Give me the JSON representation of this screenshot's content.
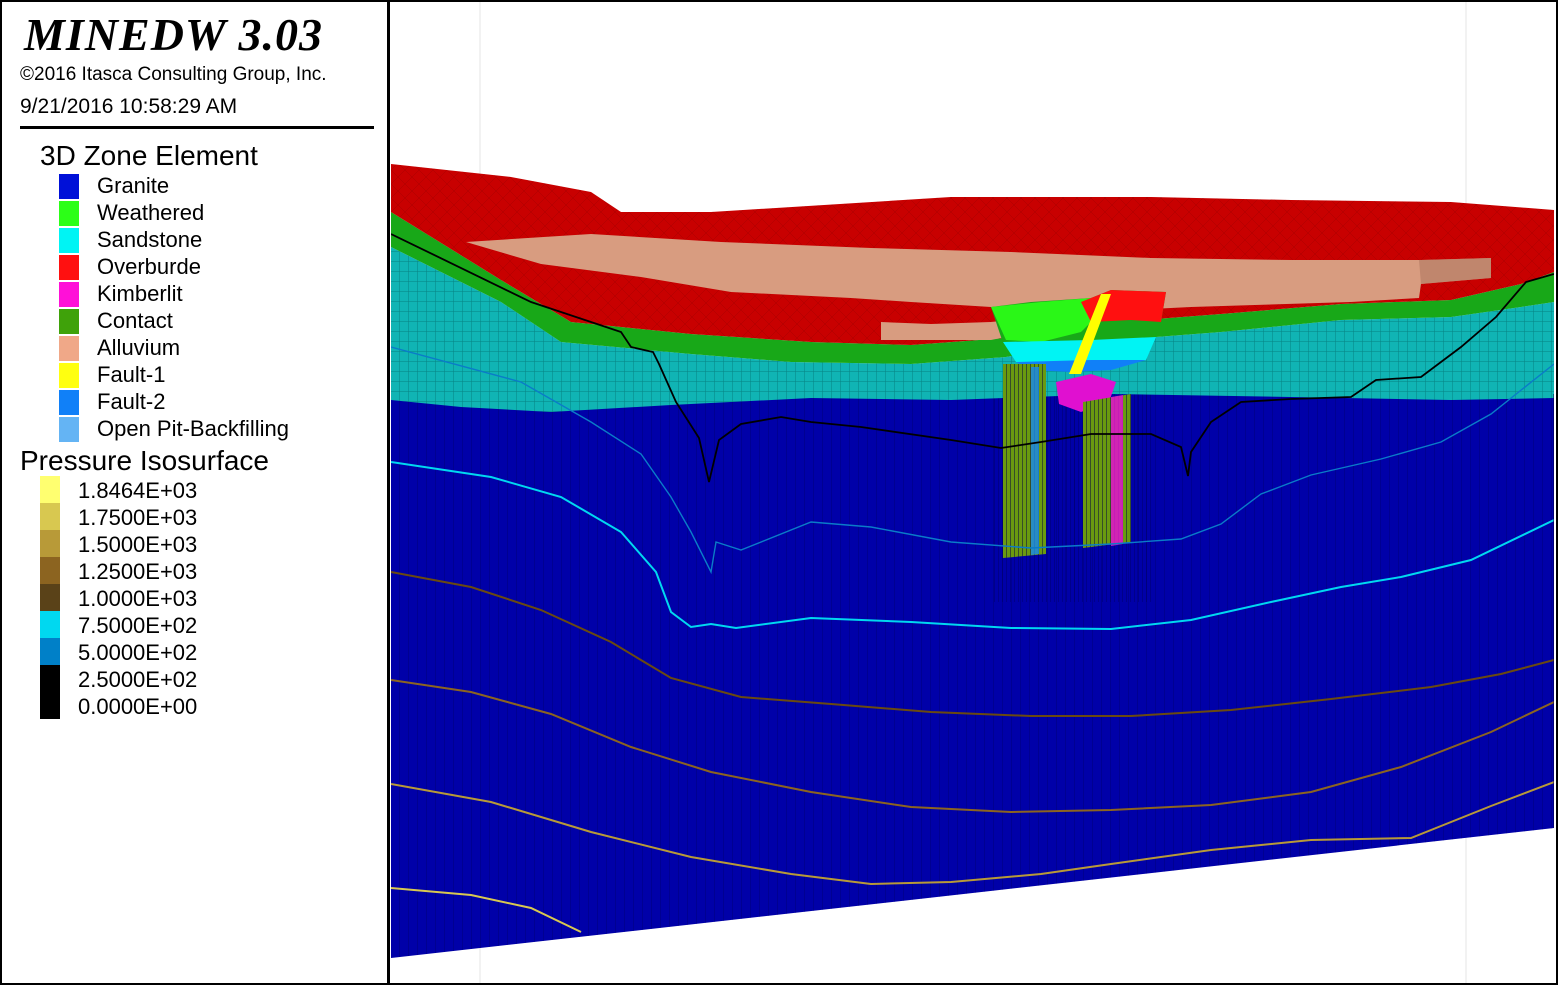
{
  "app": {
    "title": "MINEDW 3.03",
    "copyright": "©2016 Itasca Consulting Group, Inc.",
    "datetime": "9/21/2016 10:58:29 AM"
  },
  "legend": {
    "zone_heading": "3D Zone Element",
    "zone_items": [
      {
        "label": "Granite",
        "color": "#0010d8"
      },
      {
        "label": "Weathered",
        "color": "#2cff17"
      },
      {
        "label": "Sandstone",
        "color": "#00f4f4"
      },
      {
        "label": "Overburde",
        "color": "#ff1010"
      },
      {
        "label": "Kimberlit",
        "color": "#ff10d8"
      },
      {
        "label": "Contact",
        "color": "#3fa20a"
      },
      {
        "label": "Alluvium",
        "color": "#f0a888"
      },
      {
        "label": "Fault-1",
        "color": "#ffff10"
      },
      {
        "label": "Fault-2",
        "color": "#1080f8"
      },
      {
        "label": "Open Pit-Backfilling",
        "color": "#64b4f4"
      }
    ],
    "iso_heading": "Pressure Isosurface",
    "iso_items": [
      {
        "label": "1.8464E+03",
        "color": "#ffff70"
      },
      {
        "label": "1.7500E+03",
        "color": "#d8c850"
      },
      {
        "label": "1.5000E+03",
        "color": "#b89a38"
      },
      {
        "label": "1.2500E+03",
        "color": "#8c6420"
      },
      {
        "label": "1.0000E+03",
        "color": "#5a4218"
      },
      {
        "label": "7.5000E+02",
        "color": "#00d8f0"
      },
      {
        "label": "5.0000E+02",
        "color": "#0080c8"
      },
      {
        "label": "2.5000E+02",
        "color": "#000000"
      },
      {
        "label": "0.0000E+00",
        "color": "#000000"
      }
    ]
  },
  "viewport": {
    "layer_colors": {
      "granite": "#0000a8",
      "sandstone": "#10b4b4",
      "contact": "#18a818",
      "overburden": "#c80000",
      "alluvium": "#d89c80",
      "kimberlite": "#e010d0",
      "fault_1": "#ffff00",
      "fault_2": "#1888f0",
      "pipe_green": "#6a9a10"
    }
  }
}
